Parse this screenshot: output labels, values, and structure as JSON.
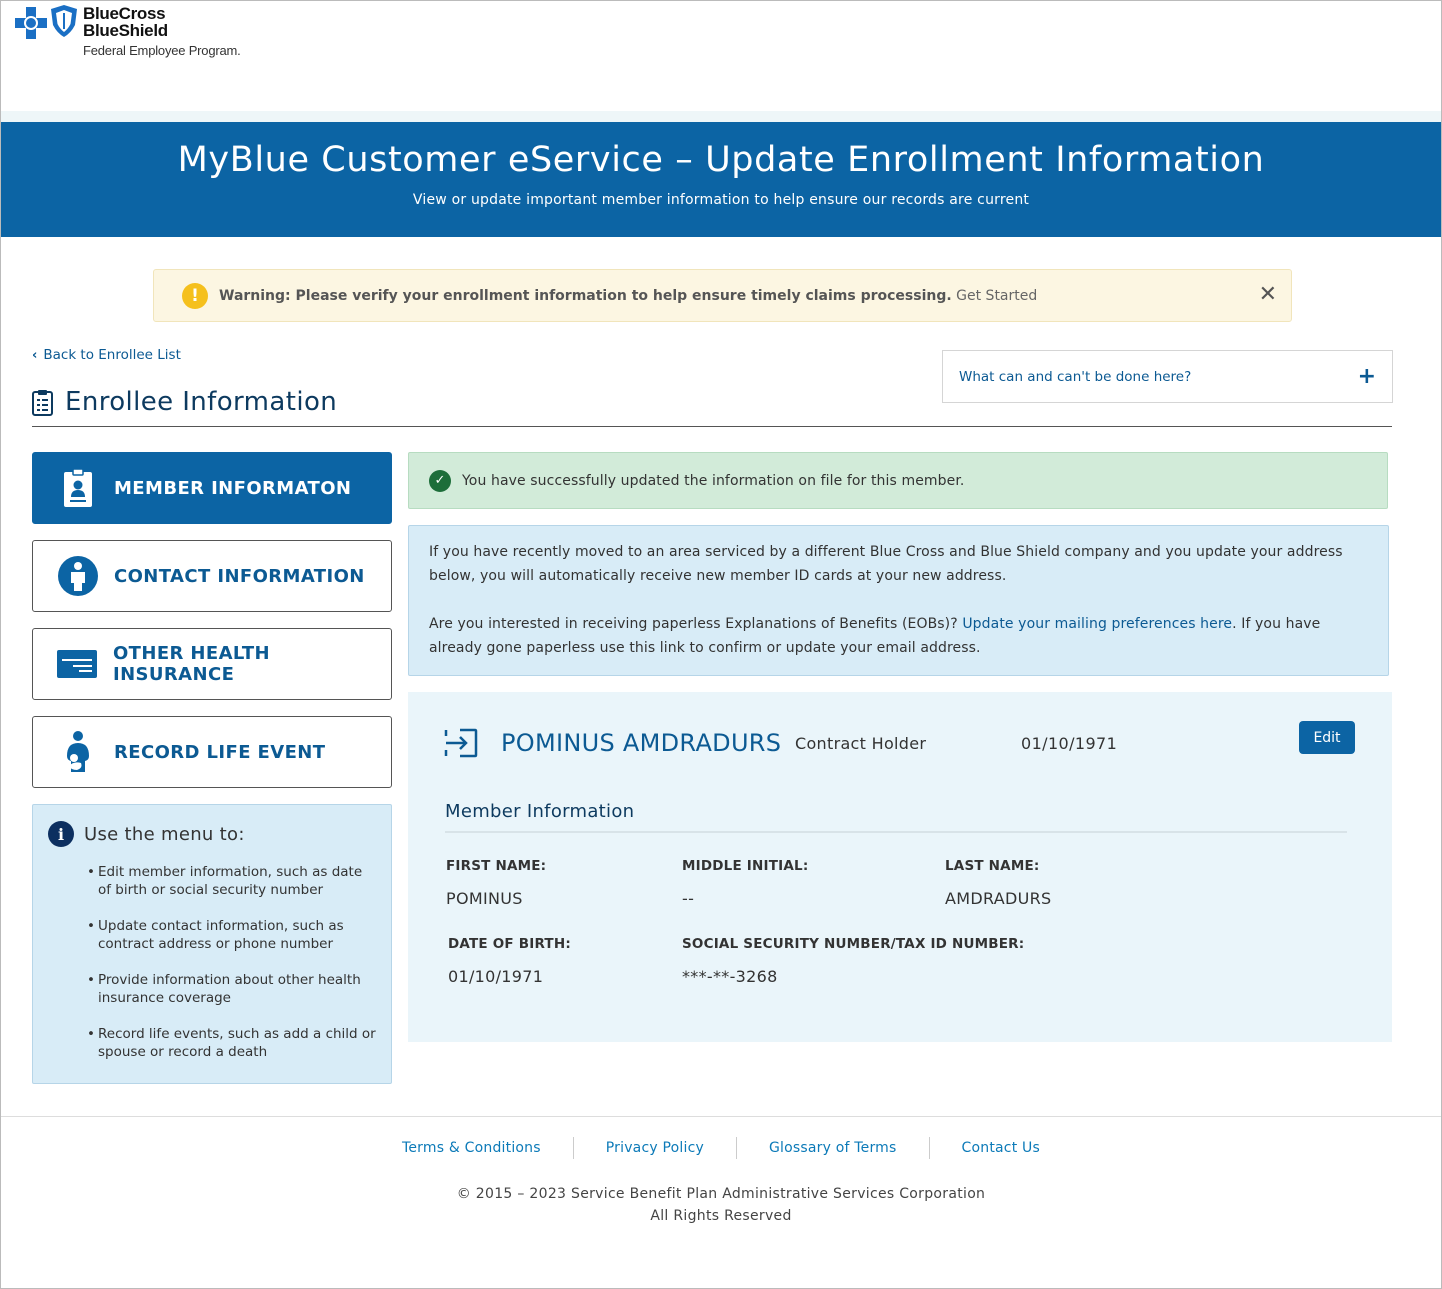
{
  "brand": {
    "line1": "BlueCross",
    "line2": "BlueShield",
    "line3": "Federal Employee Program."
  },
  "hero": {
    "title": "MyBlue Customer eService – Update Enrollment Information",
    "subtitle": "View or update important member information to help ensure our records are current"
  },
  "warning": {
    "bold": "Warning: Please verify your enrollment information to help ensure timely claims processing.",
    "link": "Get Started",
    "close": "✕"
  },
  "nav": {
    "back_label": "Back to Enrollee List",
    "heading": "Enrollee Information",
    "help_label": "What can and can't be done here?",
    "help_toggle": "+"
  },
  "menu": {
    "items": [
      {
        "label": "MEMBER INFORMATON",
        "icon": "id-badge-icon",
        "active": true
      },
      {
        "label": "CONTACT INFORMATION",
        "icon": "person-circle-icon",
        "active": false
      },
      {
        "label": "OTHER HEALTH INSURANCE",
        "icon": "card-icon",
        "active": false
      },
      {
        "label": "RECORD LIFE EVENT",
        "icon": "parent-child-icon",
        "active": false
      }
    ]
  },
  "info": {
    "title": "Use the menu to:",
    "icon_glyph": "i",
    "items": [
      "Edit member information, such as date of birth or social security number",
      "Update contact information, such as contract address or phone number",
      "Provide information about other health insurance coverage",
      "Record life events, such as add a child or spouse or record a death"
    ]
  },
  "success": {
    "text": "You have successfully updated the information on file for this member."
  },
  "notice": {
    "para1": "If you have recently moved to an area serviced by a different Blue Cross and Blue Shield company and you update your address below, you will automatically receive new member ID cards at your new address.",
    "para2_before": "Are you interested in receiving paperless Explanations of Benefits (EOBs)? ",
    "para2_link": "Update your mailing preferences here",
    "para2_after": ". If you have already gone paperless use this link to confirm or update your email address."
  },
  "member": {
    "name": "POMINUS AMDRADURS",
    "role": "Contract Holder",
    "dob_header": "01/10/1971",
    "edit_label": "Edit",
    "section_title": "Member Information",
    "fields": {
      "first_name_label": "FIRST NAME:",
      "first_name": "POMINUS",
      "middle_initial_label": "MIDDLE INITIAL:",
      "middle_initial": "--",
      "last_name_label": "LAST NAME:",
      "last_name": "AMDRADURS",
      "dob_label": "DATE OF BIRTH:",
      "dob": "01/10/1971",
      "ssn_label": "SOCIAL SECURITY NUMBER/TAX ID NUMBER:",
      "ssn": "***-**-3268"
    }
  },
  "footer": {
    "links": [
      "Terms & Conditions",
      "Privacy Policy",
      "Glossary of Terms",
      "Contact Us"
    ],
    "copyright": "© 2015 – 2023 Service Benefit Plan Administrative Services Corporation",
    "rights": "All Rights Reserved"
  },
  "colors": {
    "brand_blue": "#0c64a4",
    "link_blue": "#0c5a93",
    "warning_bg": "#fcf6e2",
    "success_bg": "#d2ebd9",
    "info_bg": "#d8ecf7"
  }
}
